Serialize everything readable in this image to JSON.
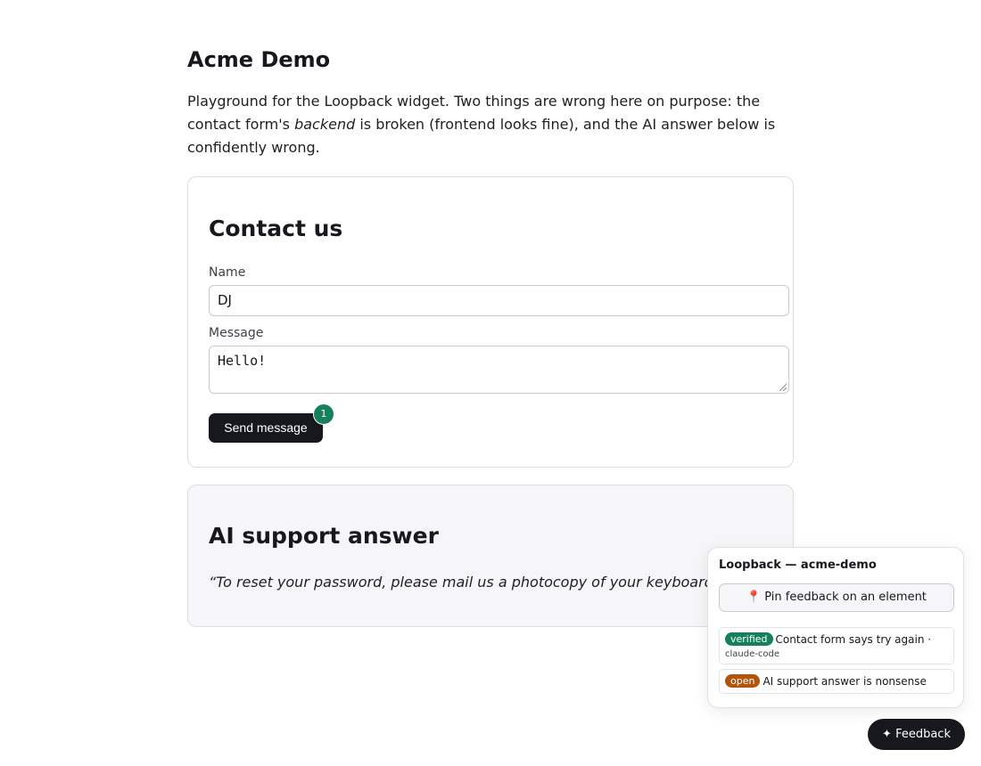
{
  "page": {
    "title": "Acme Demo",
    "intro_part1": "Playground for the Loopback widget. Two things are wrong here on purpose: the contact form's ",
    "intro_em": "backend",
    "intro_part2": " is broken (frontend looks fine), and the AI answer below is confidently wrong."
  },
  "contact": {
    "heading": "Contact us",
    "name_label": "Name",
    "name_value": "DJ",
    "message_label": "Message",
    "message_value": "Hello!",
    "send_label": "Send message",
    "pin_count": "1"
  },
  "ai": {
    "heading": "AI support answer",
    "quote": "“To reset your password, please mail us a photocopy of your keyboard.”"
  },
  "widget": {
    "panel_title": "Loopback — acme-demo",
    "pin_icon": "📍",
    "pin_button_label": "Pin feedback on an element",
    "items": [
      {
        "status": "verified",
        "text": "Contact form says try again",
        "separator": "·",
        "meta": "claude-code"
      },
      {
        "status": "open",
        "text": "AI support answer is nonsense"
      }
    ],
    "feedback_icon": "✦",
    "feedback_label": "Feedback"
  },
  "colors": {
    "verified": "#15805b",
    "open": "#b3530c",
    "dark_button": "#16181d",
    "card_alt_bg": "#f6f6f8"
  }
}
